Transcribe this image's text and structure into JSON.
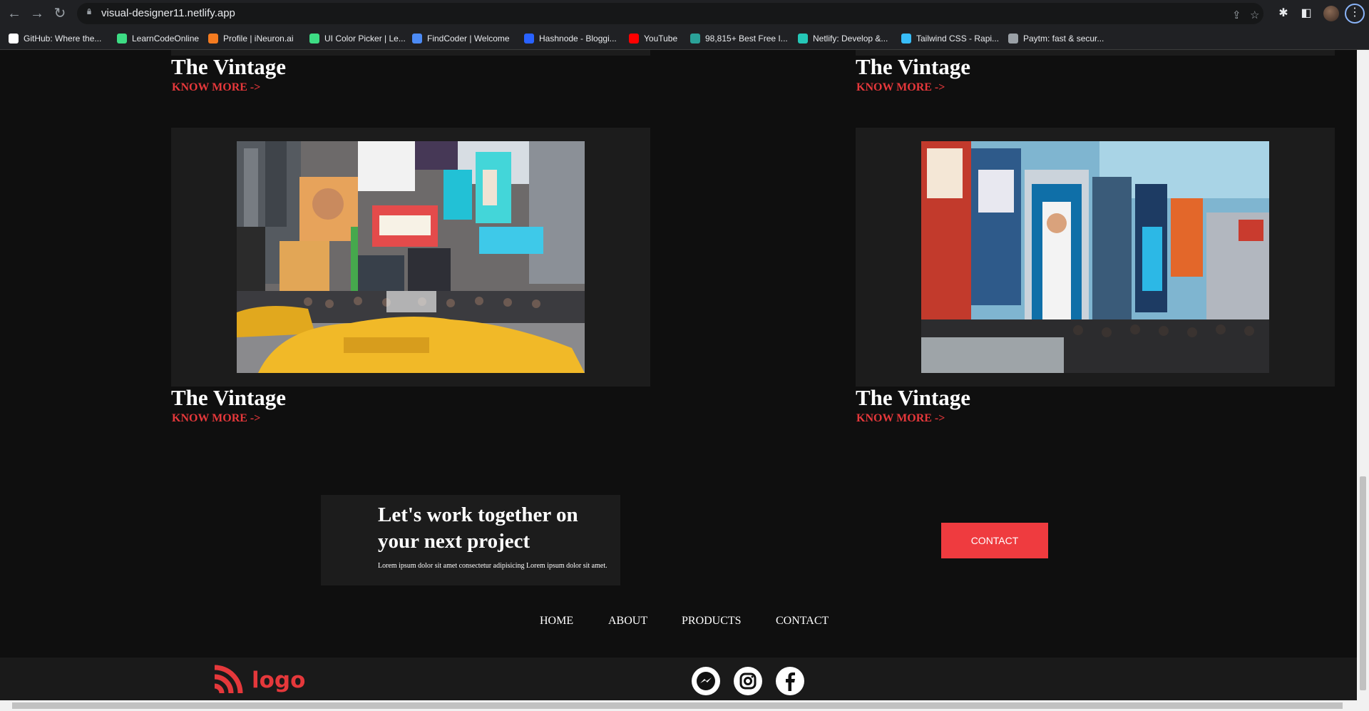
{
  "browser": {
    "url": "visual-designer11.netlify.app",
    "bookmarks": [
      {
        "label": "GitHub: Where the...",
        "icon": "github-icon",
        "color": "#ffffff"
      },
      {
        "label": "LearnCodeOnline",
        "icon": "lco-icon",
        "color": "#3ddc84"
      },
      {
        "label": "Profile | iNeuron.ai",
        "icon": "ineuron-icon",
        "color": "#f47b20"
      },
      {
        "label": "UI Color Picker | Le...",
        "icon": "lco-icon",
        "color": "#3ddc84"
      },
      {
        "label": "FindCoder | Welcome",
        "icon": "code-icon",
        "color": "#4c8bf5"
      },
      {
        "label": "Hashnode - Bloggi...",
        "icon": "hashnode-icon",
        "color": "#2962ff"
      },
      {
        "label": "YouTube",
        "icon": "youtube-icon",
        "color": "#ff0000"
      },
      {
        "label": "98,815+ Best Free I...",
        "icon": "freepik-icon",
        "color": "#2aa198"
      },
      {
        "label": "Netlify: Develop &...",
        "icon": "netlify-icon",
        "color": "#25c7b7"
      },
      {
        "label": "Tailwind CSS - Rapi...",
        "icon": "tailwind-icon",
        "color": "#38bdf8"
      },
      {
        "label": "Paytm: fast & secur...",
        "icon": "paytm-icon",
        "color": "#9aa0a6"
      }
    ]
  },
  "cards": [
    {
      "title": "The Vintage",
      "link": "KNOW MORE ->"
    },
    {
      "title": "The Vintage",
      "link": "KNOW MORE ->"
    },
    {
      "title": "The Vintage",
      "link": "KNOW MORE ->"
    },
    {
      "title": "The Vintage",
      "link": "KNOW MORE ->"
    }
  ],
  "cta": {
    "title": "Let's work together on your next project",
    "body": "Lorem ipsum dolor sit amet consectetur adipisicing Lorem ipsum dolor sit amet.",
    "button": "CONTACT"
  },
  "footer_nav": [
    "HOME",
    "ABOUT",
    "PRODUCTS",
    "CONTACT"
  ],
  "footer": {
    "logo": "logo",
    "social": [
      "messenger-icon",
      "instagram-icon",
      "facebook-icon"
    ]
  },
  "colors": {
    "accent": "#e5383b",
    "button": "#ef3b3f",
    "background": "#0f0f0f",
    "card": "#1c1c1c"
  }
}
